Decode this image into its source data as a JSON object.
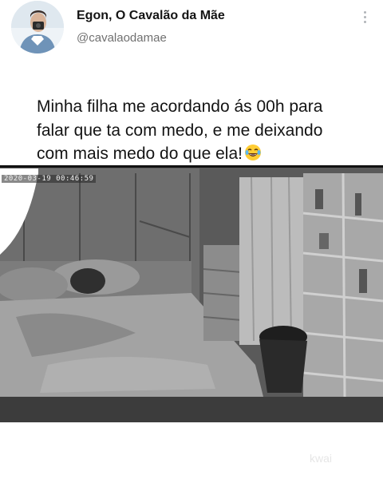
{
  "tweet": {
    "display_name": "Egon, O Cavalão da Mãe",
    "handle": "@cavalaodamae",
    "text_lines": [
      "Minha filha me acordando ás 00h para",
      "falar que ta com medo, e me deixando",
      "com mais medo do que ela!"
    ],
    "emoji": "laughing-with-tears-emoji"
  },
  "video": {
    "timestamp": "2020-03-19  00:46:59"
  },
  "watermark": "kwai"
}
